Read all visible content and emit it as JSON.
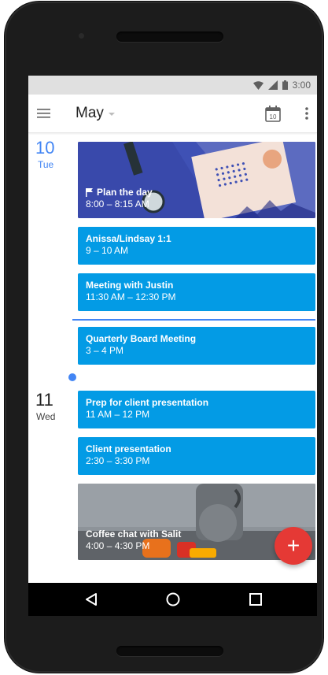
{
  "status_bar": {
    "time": "3:00",
    "icons": [
      "wifi-icon",
      "signal-icon",
      "battery-icon"
    ]
  },
  "app_bar": {
    "month": "May",
    "today_icon_label": "10",
    "icons": [
      "menu-icon",
      "calendar-today-icon",
      "more-vert-icon"
    ]
  },
  "days": [
    {
      "date": "10",
      "weekday": "Tue",
      "is_today": true,
      "events": [
        {
          "title": "Plan the day",
          "time": "8:00 – 8:15 AM",
          "style": "banner",
          "flag": true
        },
        {
          "title": "Anissa/Lindsay 1:1",
          "time": "9 – 10 AM",
          "style": "plain"
        },
        {
          "title": "Meeting with Justin",
          "time": "11:30 AM – 12:30 PM",
          "style": "plain"
        },
        {
          "title": "Quarterly Board Meeting",
          "time": "3 – 4 PM",
          "style": "plain"
        }
      ]
    },
    {
      "date": "11",
      "weekday": "Wed",
      "is_today": false,
      "events": [
        {
          "title": "Prep for client presentation",
          "time": "11 AM – 12 PM",
          "style": "plain"
        },
        {
          "title": "Client presentation",
          "time": "2:30 – 3:30 PM",
          "style": "plain"
        },
        {
          "title": "Coffee chat with Salit",
          "time": "4:00 – 4:30 PM",
          "style": "photo"
        }
      ]
    }
  ],
  "fab_label": "+",
  "nav_bar": {
    "icons": [
      "back-icon",
      "home-icon",
      "recents-icon"
    ]
  },
  "colors": {
    "event_blue": "#039be5",
    "banner_navy": "#3949ab",
    "today_blue": "#4285f4",
    "fab_red": "#e53935",
    "status_bar_gray": "#e0e0e0"
  }
}
